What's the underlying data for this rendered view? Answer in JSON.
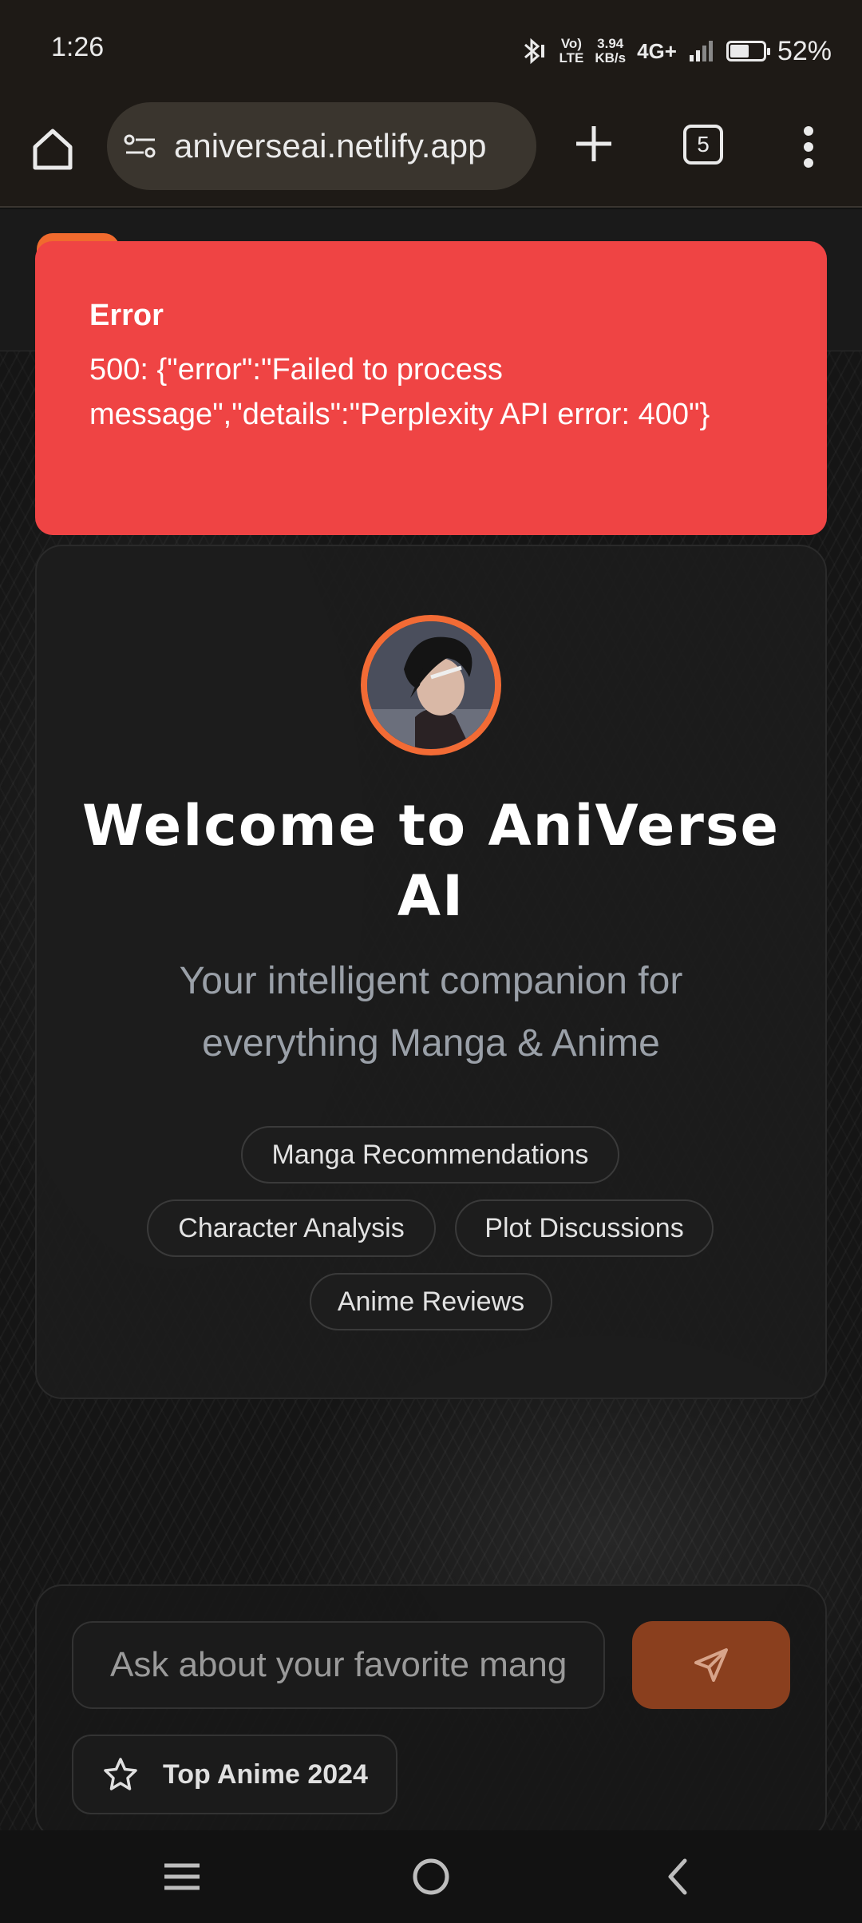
{
  "status_bar": {
    "time": "1:26",
    "lte_top": "Vo)",
    "lte_bottom": "LTE",
    "speed_value": "3.94",
    "speed_unit": "KB/s",
    "network": "4G+",
    "battery_percent": "52%",
    "battery_level": 0.52
  },
  "browser": {
    "url": "aniverseai.netlify.app",
    "tab_count": "5"
  },
  "error": {
    "title": "Error",
    "message": "500: {\"error\":\"Failed to process message\",\"details\":\"Perplexity API error: 400\"}"
  },
  "welcome": {
    "title": "Welcome to AniVerse AI",
    "subtitle": "Your intelligent companion for everything Manga & Anime",
    "topics": [
      "Manga Recommendations",
      "Character Analysis",
      "Plot Discussions",
      "Anime Reviews"
    ]
  },
  "chat": {
    "placeholder": "Ask about your favorite manga or anime...",
    "suggestion": "Top Anime 2024"
  },
  "colors": {
    "accent": "#f26b35",
    "error": "#ef4444",
    "send_button": "#8a3f1e"
  }
}
